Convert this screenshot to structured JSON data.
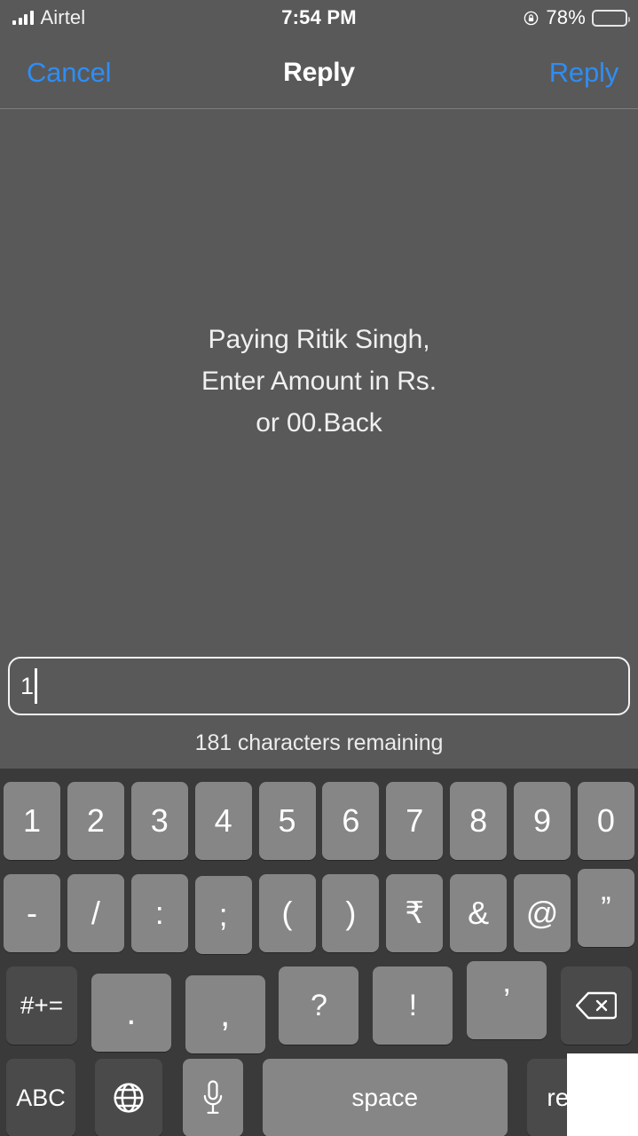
{
  "status_bar": {
    "carrier": "Airtel",
    "signal_bars_filled": 4,
    "signal_bars_total": 4,
    "time": "7:54 PM",
    "battery_percent": "78%",
    "battery_level": 78,
    "rotation_lock_icon": "rotation-lock-icon",
    "battery_icon": "battery-icon"
  },
  "nav_bar": {
    "cancel_label": "Cancel",
    "title": "Reply",
    "send_label": "Reply",
    "accent_color": "#2f8df3"
  },
  "message": {
    "text": "Paying Ritik  Singh,\nEnter Amount in Rs.\nor 00.Back"
  },
  "compose": {
    "value": "1",
    "placeholder": "",
    "char_counter": "181 characters remaining",
    "characters_remaining": 181
  },
  "keyboard": {
    "rows": {
      "numbers": [
        "1",
        "2",
        "3",
        "4",
        "5",
        "6",
        "7",
        "8",
        "9",
        "0"
      ],
      "symbols": [
        "-",
        "/",
        ":",
        ";",
        "(",
        ")",
        "₹",
        "&",
        "@",
        "”"
      ],
      "punctuation": [
        "#+=",
        ".",
        ",",
        "?",
        "!",
        "’"
      ],
      "bottom": [
        "ABC",
        "globe-icon",
        "microphone-icon",
        "space",
        "return"
      ]
    },
    "delete_icon": "backspace-icon",
    "globe_icon": "globe-icon",
    "microphone_icon": "microphone-icon",
    "space_label": "space",
    "return_label": "return",
    "abc_label": "ABC",
    "symbols_toggle_label": "#+="
  },
  "colors": {
    "background": "#595959",
    "keyboard_background": "#3a3a3a",
    "key": "#868686",
    "key_dark": "#4a4a4a",
    "accent_blue": "#2f8df3",
    "text": "#ffffff"
  }
}
